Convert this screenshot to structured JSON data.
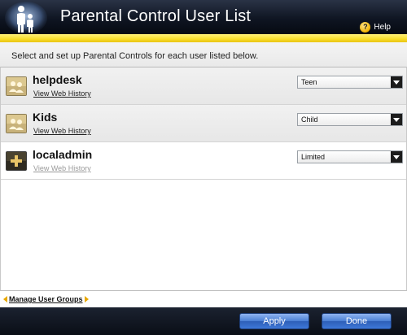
{
  "header": {
    "title": "Parental Control User List",
    "help_label": "Help",
    "logo_icon": "parent-child-silhouette-icon",
    "help_icon": "question-circle-icon"
  },
  "instruction": "Select and set up Parental Controls for each user listed below.",
  "users": [
    {
      "name": "helpdesk",
      "web_history_label": "View Web History",
      "web_history_enabled": true,
      "level": "Teen",
      "icon": "users-group-icon"
    },
    {
      "name": "Kids",
      "web_history_label": "View Web History",
      "web_history_enabled": true,
      "level": "Child",
      "icon": "users-group-icon"
    },
    {
      "name": "localadmin",
      "web_history_label": "View Web History",
      "web_history_enabled": false,
      "level": "Limited",
      "icon": "add-user-icon"
    }
  ],
  "footer": {
    "manage_label": "Manage User Groups",
    "apply_label": "Apply",
    "done_label": "Done"
  },
  "colors": {
    "header_bg": "#0f1522",
    "accent_yellow": "#f7dc2a",
    "button_blue": "#4a7fd4",
    "help_gold": "#f2b400"
  }
}
